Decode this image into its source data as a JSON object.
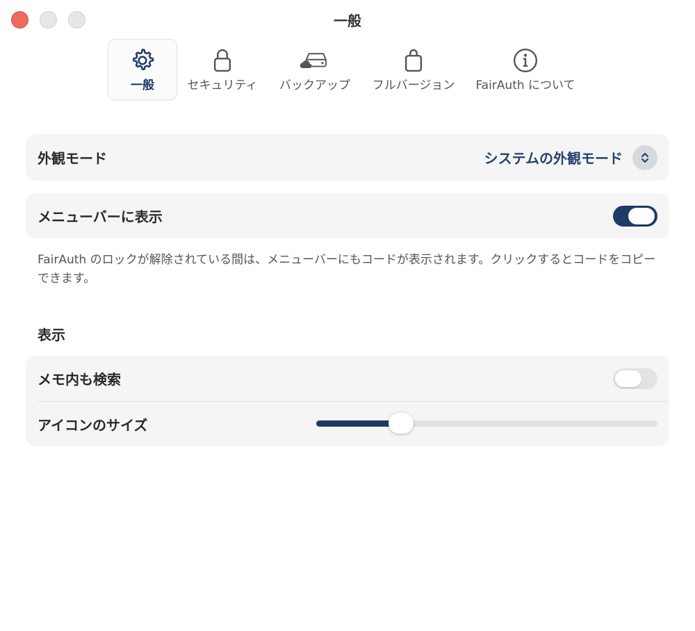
{
  "window": {
    "title": "一般"
  },
  "toolbar": {
    "tabs": [
      {
        "label": "一般",
        "icon": "gear-icon",
        "active": true
      },
      {
        "label": "セキュリティ",
        "icon": "lock-icon",
        "active": false
      },
      {
        "label": "バックアップ",
        "icon": "cloud-drive-icon",
        "active": false
      },
      {
        "label": "フルバージョン",
        "icon": "shopping-bag-icon",
        "active": false
      },
      {
        "label": "FairAuth について",
        "icon": "info-icon",
        "active": false
      }
    ]
  },
  "appearance": {
    "label": "外観モード",
    "value": "システムの外観モード"
  },
  "menubar": {
    "label": "メニューバーに表示",
    "enabled": true
  },
  "note": "FairAuth のロックが解除されている間は、メニューバーにもコードが表示されます。クリックするとコードをコピーできます。",
  "display": {
    "section_title": "表示",
    "search_memo": {
      "label": "メモ内も検索",
      "enabled": false
    },
    "icon_size": {
      "label": "アイコンのサイズ",
      "value_fraction": 0.19
    }
  },
  "colors": {
    "accent": "#1f3a66",
    "close": "#ec6a5e",
    "card": "#f5f5f5"
  }
}
